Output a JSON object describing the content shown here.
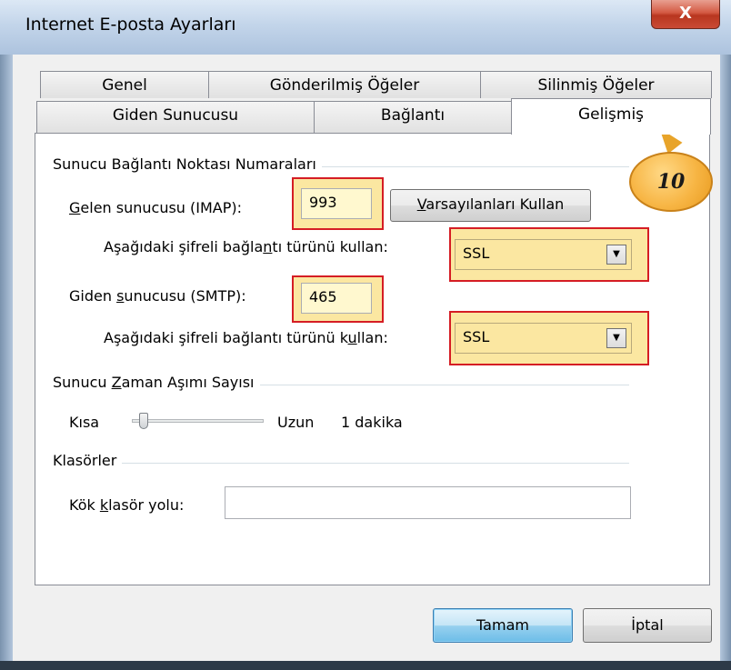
{
  "window": {
    "title": "Internet E-posta Ayarları",
    "close_glyph": "X"
  },
  "tabs": {
    "row_back": [
      "Genel",
      "Gönderilmiş Öğeler",
      "Silinmiş Öğeler"
    ],
    "row_front": [
      "Giden Sunucusu",
      "Bağlantı",
      "Gelişmiş"
    ],
    "active": "Gelişmiş"
  },
  "annotation": {
    "badge_number": "10",
    "colors": {
      "badge": "#f7b544",
      "highlight_border": "#d51d24",
      "highlight_fill": "#fbe7a1"
    }
  },
  "ports": {
    "group_title": "Sunucu Bağlantı Noktası Numaraları",
    "imap_label_prefix": "G",
    "imap_label_rest": "elen sunucusu (IMAP):",
    "imap_value": "993",
    "defaults_button_prefix": "V",
    "defaults_button_rest": "arsayılanları Kullan",
    "enc1_label_a": "Aşağıdaki şifreli bağla",
    "enc1_label_u": "n",
    "enc1_label_b": "tı türünü kullan:",
    "enc1_value": "SSL",
    "smtp_label_a": "Giden ",
    "smtp_label_u": "s",
    "smtp_label_b": "unucusu (SMTP):",
    "smtp_value": "465",
    "enc2_label_a": "Aşağıdaki şifreli bağlantı türünü k",
    "enc2_label_u": "u",
    "enc2_label_b": "llan:",
    "enc2_value": "SSL"
  },
  "timeout": {
    "group_title_a": "Sunucu ",
    "group_title_u": "Z",
    "group_title_b": "aman Aşımı Sayısı",
    "short_label": "Kısa",
    "long_label": "Uzun",
    "value_text": "1 dakika",
    "slider_level": 0.0
  },
  "folders": {
    "group_title": "Klasörler",
    "root_label_a": "Kök ",
    "root_label_u": "k",
    "root_label_b": "lasör yolu:",
    "root_value": ""
  },
  "buttons": {
    "ok": "Tamam",
    "cancel": "İptal"
  }
}
